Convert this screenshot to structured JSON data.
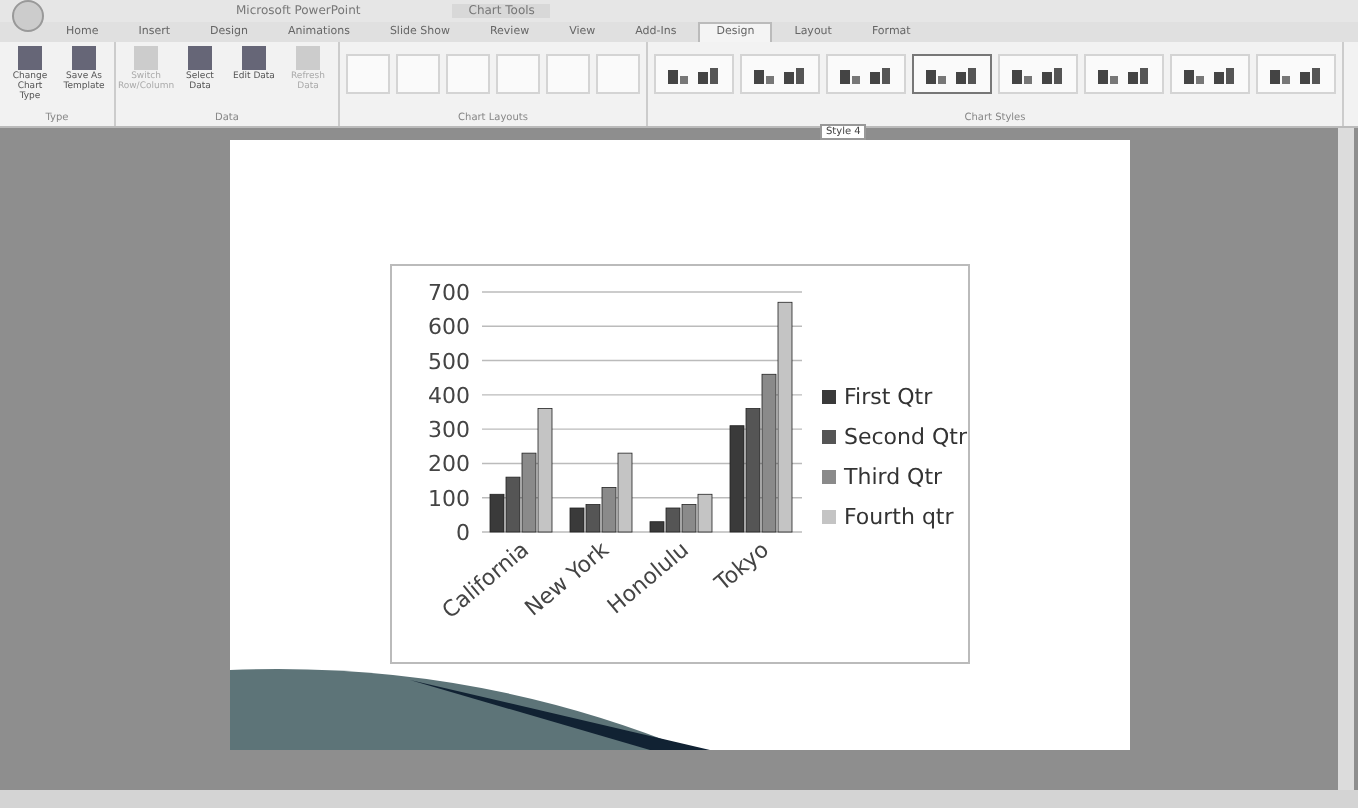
{
  "window": {
    "title": "Microsoft PowerPoint",
    "context_title": "Chart Tools"
  },
  "tabs": [
    {
      "label": "Home",
      "selected": false
    },
    {
      "label": "Insert",
      "selected": false
    },
    {
      "label": "Design",
      "selected": false
    },
    {
      "label": "Animations",
      "selected": false
    },
    {
      "label": "Slide Show",
      "selected": false
    },
    {
      "label": "Review",
      "selected": false
    },
    {
      "label": "View",
      "selected": false
    },
    {
      "label": "Add-Ins",
      "selected": false
    },
    {
      "label": "Design",
      "selected": true
    },
    {
      "label": "Layout",
      "selected": false
    },
    {
      "label": "Format",
      "selected": false
    }
  ],
  "ribbon": {
    "groups": [
      {
        "label": "Type",
        "buttons": [
          {
            "label": "Change Chart Type",
            "disabled": false
          },
          {
            "label": "Save As Template",
            "disabled": false
          }
        ]
      },
      {
        "label": "Data",
        "buttons": [
          {
            "label": "Switch Row/Column",
            "disabled": true
          },
          {
            "label": "Select Data",
            "disabled": false
          },
          {
            "label": "Edit Data",
            "disabled": false
          },
          {
            "label": "Refresh Data",
            "disabled": true
          }
        ]
      }
    ],
    "layouts_label": "Chart Layouts",
    "layouts": [
      {
        "selected": false
      },
      {
        "selected": false
      },
      {
        "selected": false
      },
      {
        "selected": false
      },
      {
        "selected": false
      },
      {
        "selected": false
      }
    ],
    "styles_label": "Chart Styles",
    "styles": [
      {
        "selected": false
      },
      {
        "selected": false
      },
      {
        "selected": false
      },
      {
        "selected": true
      },
      {
        "selected": false
      },
      {
        "selected": false
      },
      {
        "selected": false
      },
      {
        "selected": false
      }
    ],
    "tooltip": "Style 4"
  },
  "slide": {
    "chart": {
      "chart_data": {
        "type": "bar",
        "grid": true,
        "legend": true,
        "categories": [
          "California",
          "New York",
          "Honolulu",
          "Tokyo"
        ],
        "ylim": [
          0,
          700
        ],
        "yticks": [
          0,
          100,
          200,
          300,
          400,
          500,
          600,
          700
        ],
        "series": [
          {
            "name": "First Qtr",
            "color": "#3a3a3a",
            "values": [
              110,
              70,
              30,
              310
            ]
          },
          {
            "name": "Second Qtr",
            "color": "#555555",
            "values": [
              160,
              80,
              70,
              360
            ]
          },
          {
            "name": "Third Qtr",
            "color": "#8a8a8a",
            "values": [
              230,
              130,
              80,
              460
            ]
          },
          {
            "name": "Fourth qtr",
            "color": "#c4c4c4",
            "values": [
              360,
              230,
              110,
              670
            ]
          }
        ]
      }
    }
  }
}
